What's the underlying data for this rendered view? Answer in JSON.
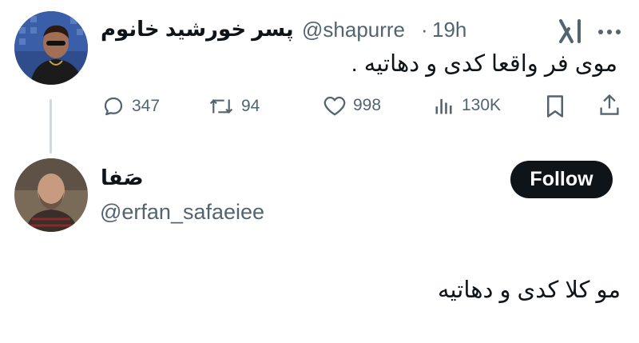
{
  "tweet": {
    "display_name": "پسر خورشید خانوم",
    "handle": "@shapurre",
    "separator": "·",
    "time": "19h",
    "text": "موی فر واقعا کدی و دهاتیه .",
    "actions": {
      "replies": "347",
      "retweets": "94",
      "likes": "998",
      "views": "130K"
    },
    "icons": [
      "grok-icon",
      "more-icon",
      "reply-icon",
      "retweet-icon",
      "like-icon",
      "views-icon",
      "bookmark-icon",
      "share-icon"
    ]
  },
  "reply": {
    "display_name": "صَفا",
    "handle": "@erfan_safaeiee",
    "follow_label": "Follow",
    "text": "مو کلا کدی و دهاتیه"
  },
  "colors": {
    "text_primary": "#0f1419",
    "text_secondary": "#536471",
    "thread_line": "#cfd9de",
    "follow_bg": "#0f1419"
  }
}
